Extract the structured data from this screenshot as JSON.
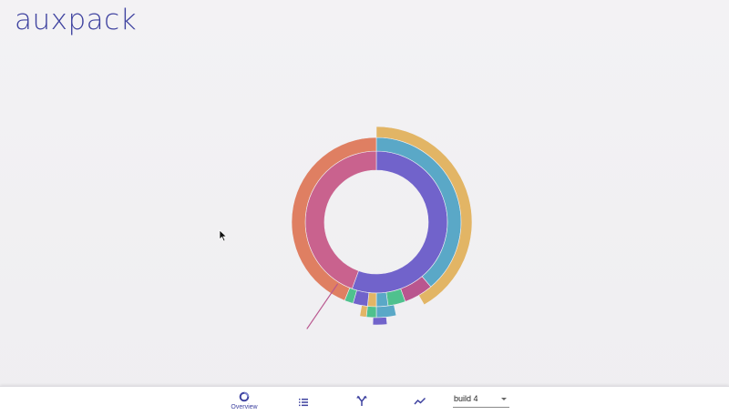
{
  "app": {
    "title": "auxpack"
  },
  "nav": {
    "items": [
      {
        "name": "overview",
        "label": "Overview",
        "icon": "donut-chart-icon",
        "active": true
      },
      {
        "name": "list",
        "label": "",
        "icon": "list-icon",
        "active": false
      },
      {
        "name": "tree",
        "label": "",
        "icon": "branch-icon",
        "active": false
      },
      {
        "name": "trends",
        "label": "",
        "icon": "line-chart-icon",
        "active": false
      }
    ],
    "build_select": {
      "value": "build 4"
    }
  },
  "colors": {
    "brand": "#3f43a0",
    "purple": "#7163cb",
    "blue": "#5aa8c7",
    "gold": "#e2b565",
    "pink": "#c9628e",
    "orange": "#df7f62",
    "green": "#4fc18e",
    "magenta": "#b9568f"
  },
  "chart_data": {
    "type": "sunburst",
    "rings": [
      {
        "level": 1,
        "segments": [
          {
            "color": "#7163cb",
            "start_deg": 0,
            "end_deg": 200
          },
          {
            "color": "#c9628e",
            "start_deg": 200,
            "end_deg": 360
          }
        ]
      },
      {
        "level": 2,
        "segments": [
          {
            "color": "#5aa8c7",
            "start_deg": 0,
            "end_deg": 140
          },
          {
            "color": "#b9568f",
            "start_deg": 140,
            "end_deg": 160
          },
          {
            "color": "#4fc18e",
            "start_deg": 160,
            "end_deg": 172
          },
          {
            "color": "#5aa8c7",
            "start_deg": 172,
            "end_deg": 180
          },
          {
            "color": "#e2b565",
            "start_deg": 180,
            "end_deg": 186
          },
          {
            "color": "#7163cb",
            "start_deg": 186,
            "end_deg": 196
          },
          {
            "color": "#4fc18e",
            "start_deg": 196,
            "end_deg": 202
          },
          {
            "color": "#df7f62",
            "start_deg": 202,
            "end_deg": 360
          }
        ]
      },
      {
        "level": 3,
        "segments": [
          {
            "color": "#e2b565",
            "start_deg": 0,
            "end_deg": 150
          },
          {
            "color": "#5aa8c7",
            "start_deg": 168,
            "end_deg": 180
          },
          {
            "color": "#4fc18e",
            "start_deg": 180,
            "end_deg": 186
          },
          {
            "color": "#e2b565",
            "start_deg": 186,
            "end_deg": 190
          }
        ]
      },
      {
        "level": 4,
        "segments": [
          {
            "color": "#7163cb",
            "start_deg": 174,
            "end_deg": 182
          }
        ]
      }
    ]
  }
}
